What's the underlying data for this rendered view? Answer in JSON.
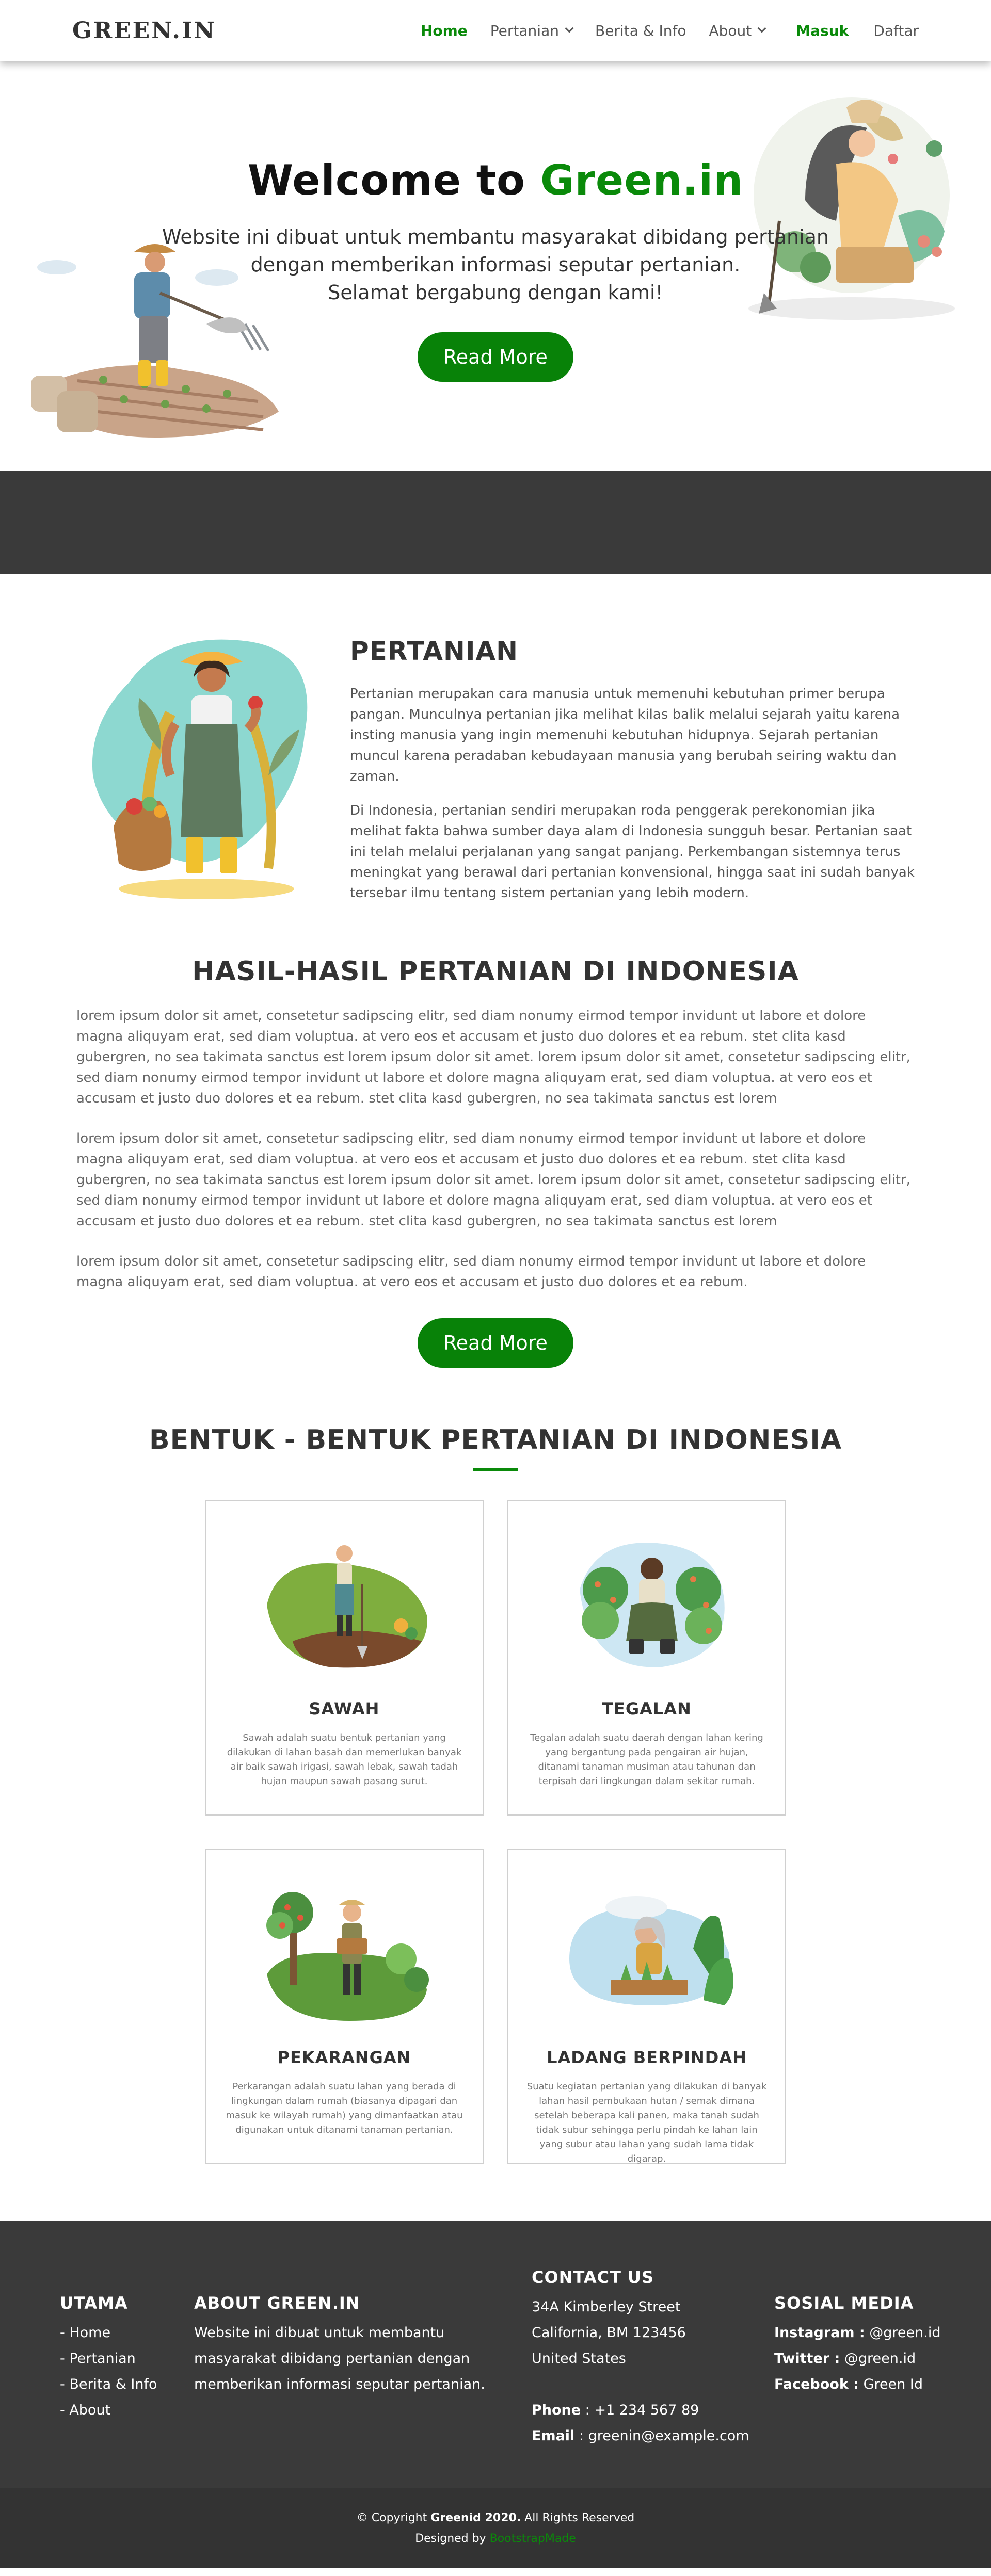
{
  "nav": {
    "brand": "GREEN.IN",
    "links": [
      "Home",
      "Pertanian",
      "Berita & Info",
      "About"
    ],
    "login": "Masuk",
    "register": "Daftar"
  },
  "hero": {
    "title_prefix": "Welcome to ",
    "title_accent": "Green.in",
    "line1": "Website ini dibuat untuk membantu masyarakat dibidang pertanian",
    "line2": "dengan memberikan informasi seputar pertanian.",
    "line3": "Selamat bergabung dengan kami!",
    "button": "Read More"
  },
  "pertanian": {
    "title": "PERTANIAN",
    "p1": "Pertanian merupakan cara manusia untuk memenuhi kebutuhan primer berupa pangan. Munculnya pertanian jika melihat kilas balik melalui sejarah yaitu karena insting manusia yang ingin memenuhi kebutuhan hidupnya. Sejarah pertanian muncul karena peradaban kebudayaan manusia yang berubah seiring waktu dan zaman.",
    "p2": "Di Indonesia, pertanian sendiri merupakan roda penggerak perekonomian jika melihat fakta bahwa sumber daya alam di Indonesia sungguh besar. Pertanian saat ini telah melalui perjalanan yang sangat panjang. Perkembangan sistemnya terus meningkat yang berawal dari pertanian konvensional, hingga saat ini sudah banyak tersebar ilmu tentang sistem pertanian yang lebih modern."
  },
  "hasil": {
    "title": "HASIL-HASIL PERTANIAN DI INDONESIA",
    "p1": "lorem ipsum dolor sit amet, consetetur sadipscing elitr, sed diam nonumy eirmod tempor invidunt ut labore et dolore magna aliquyam erat, sed diam voluptua. at vero eos et accusam et justo duo dolores et ea rebum. stet clita kasd gubergren, no sea takimata sanctus est lorem ipsum dolor sit amet. lorem ipsum dolor sit amet, consetetur sadipscing elitr, sed diam nonumy eirmod tempor invidunt ut labore et dolore magna aliquyam erat, sed diam voluptua. at vero eos et accusam et justo duo dolores et ea rebum. stet clita kasd gubergren, no sea takimata sanctus est lorem",
    "p2": "lorem ipsum dolor sit amet, consetetur sadipscing elitr, sed diam nonumy eirmod tempor invidunt ut labore et dolore magna aliquyam erat, sed diam voluptua. at vero eos et accusam et justo duo dolores et ea rebum. stet clita kasd gubergren, no sea takimata sanctus est lorem ipsum dolor sit amet. lorem ipsum dolor sit amet, consetetur sadipscing elitr, sed diam nonumy eirmod tempor invidunt ut labore et dolore magna aliquyam erat, sed diam voluptua. at vero eos et accusam et justo duo dolores et ea rebum. stet clita kasd gubergren, no sea takimata sanctus est lorem",
    "p3": "lorem ipsum dolor sit amet, consetetur sadipscing elitr, sed diam nonumy eirmod tempor invidunt ut labore et dolore magna aliquyam erat, sed diam voluptua. at vero eos et accusam et justo duo dolores et ea rebum.",
    "button": "Read More"
  },
  "bentuk": {
    "title": "BENTUK - BENTUK PERTANIAN DI INDONESIA",
    "cards": [
      {
        "title": "SAWAH",
        "desc": "Sawah adalah suatu bentuk pertanian yang dilakukan di lahan basah dan memerlukan banyak air baik sawah irigasi, sawah lebak, sawah tadah hujan maupun sawah pasang surut."
      },
      {
        "title": "TEGALAN",
        "desc": "Tegalan adalah suatu daerah dengan lahan kering yang bergantung pada pengairan air hujan, ditanami tanaman musiman atau tahunan dan terpisah dari lingkungan dalam sekitar rumah."
      },
      {
        "title": "PEKARANGAN",
        "desc": "Perkarangan adalah suatu lahan yang berada di lingkungan dalam rumah (biasanya dipagari dan masuk ke wilayah rumah) yang dimanfaatkan atau digunakan untuk ditanami tanaman pertanian."
      },
      {
        "title": "LADANG BERPINDAH",
        "desc": "Suatu kegiatan pertanian yang dilakukan di banyak lahan hasil pembukaan hutan / semak dimana setelah beberapa kali panen, maka tanah sudah tidak subur sehingga perlu pindah ke lahan lain yang subur atau lahan yang sudah lama tidak digarap."
      }
    ]
  },
  "footer": {
    "utama_title": "UTAMA",
    "utama_links": [
      "- Home",
      "- Pertanian",
      "- Berita & Info",
      "- About"
    ],
    "about_title": "ABOUT GREEN.IN",
    "about_text": "Website ini dibuat untuk membantu masyarakat dibidang pertanian dengan memberikan informasi seputar pertanian.",
    "contact_title": "CONTACT US",
    "address1": "34A Kimberley Street",
    "address2": "California, BM 123456",
    "address3": "United States",
    "phone_label": "Phone",
    "phone": " : +1 234 567 89",
    "email_label": "Email",
    "email": " : greenin@example.com",
    "social_title": "SOSIAL MEDIA",
    "instagram_label": "Instagram :",
    "instagram": " @green.id",
    "twitter_label": "Twitter :",
    "twitter": " @green.id",
    "facebook_label": "Facebook :",
    "facebook": " Green Id"
  },
  "copyright": {
    "prefix": "© Copyright ",
    "bold": "Greenid 2020.",
    "suffix": " All Rights Reserved",
    "designed": "Designed by ",
    "designer": "BootstrapMade"
  },
  "colors": {
    "primary_green": "#088208",
    "dark_band": "#3a3a3a"
  }
}
